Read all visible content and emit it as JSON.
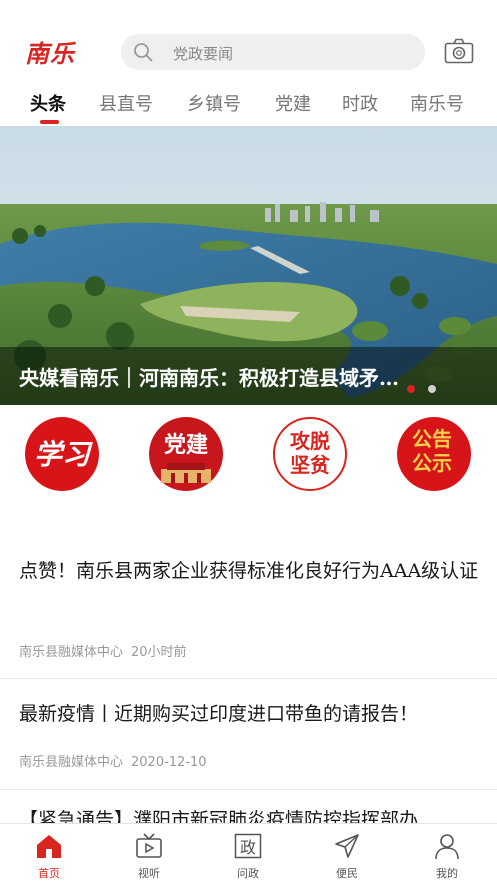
{
  "header": {
    "logo": "南乐",
    "search_placeholder": "党政要闻",
    "search_icon": "search-icon",
    "camera_icon": "camera-icon"
  },
  "tabs": [
    {
      "label": "头条",
      "active": true
    },
    {
      "label": "县直号",
      "active": false
    },
    {
      "label": "乡镇号",
      "active": false
    },
    {
      "label": "党建",
      "active": false
    },
    {
      "label": "时政",
      "active": false
    },
    {
      "label": "南乐号",
      "active": false
    }
  ],
  "banner": {
    "caption": "央媒看南乐｜河南南乐：积极打造县域矛…",
    "slide_count": 2,
    "active_slide": 1
  },
  "quick_entries": [
    {
      "text": "学习",
      "icon": "study-badge-icon"
    },
    {
      "text": "党建",
      "icon": "party-building-badge-icon"
    },
    {
      "text": "攻脱坚贫",
      "icon": "poverty-alleviation-badge-icon"
    },
    {
      "text": "公告公示",
      "icon": "announcement-badge-icon"
    }
  ],
  "news": [
    {
      "title": "点赞！南乐县两家企业获得标准化良好行为AAA级认证",
      "source": "南乐县融媒体中心",
      "time": "20小时前"
    },
    {
      "title": "最新疫情丨近期购买过印度进口带鱼的请报告！",
      "source": "南乐县融媒体中心",
      "time": "2020-12-10"
    },
    {
      "title": "【紧急通告】濮阳市新冠肺炎疫情防控指挥部办",
      "source": "",
      "time": ""
    }
  ],
  "bottom_nav": [
    {
      "label": "首页",
      "icon": "home-icon",
      "active": true
    },
    {
      "label": "视听",
      "icon": "tv-icon",
      "active": false
    },
    {
      "label": "问政",
      "icon": "zheng-icon",
      "active": false
    },
    {
      "label": "便民",
      "icon": "send-icon",
      "active": false
    },
    {
      "label": "我的",
      "icon": "user-icon",
      "active": false
    }
  ],
  "colors": {
    "brand_red": "#d8251f",
    "text": "#1a1a1a",
    "meta": "#999999"
  }
}
